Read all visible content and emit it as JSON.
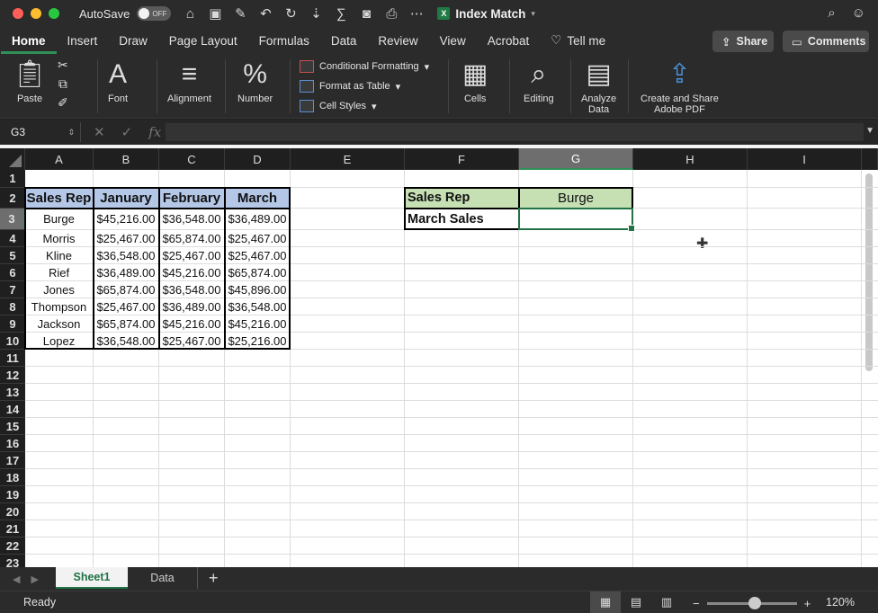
{
  "titlebar": {
    "autosave_label": "AutoSave",
    "autosave_state": "OFF",
    "doc_title": "Index Match",
    "doc_badge": "X"
  },
  "tabs": [
    "Home",
    "Insert",
    "Draw",
    "Page Layout",
    "Formulas",
    "Data",
    "Review",
    "View",
    "Acrobat"
  ],
  "tellme": "Tell me",
  "share": "Share",
  "comments": "Comments",
  "ribbon": {
    "paste": "Paste",
    "font": "Font",
    "alignment": "Alignment",
    "number": "Number",
    "conditional_formatting": "Conditional Formatting",
    "format_as_table": "Format as Table",
    "cell_styles": "Cell Styles",
    "cells": "Cells",
    "editing": "Editing",
    "analyze_data_1": "Analyze",
    "analyze_data_2": "Data",
    "create_share_1": "Create and Share",
    "create_share_2": "Adobe PDF"
  },
  "formula_bar": {
    "name_box": "G3",
    "fx": "fx",
    "value": ""
  },
  "grid": {
    "columns": [
      "A",
      "B",
      "C",
      "D",
      "E",
      "F",
      "G",
      "H",
      "I"
    ],
    "rows": [
      "1",
      "2",
      "3",
      "4",
      "5",
      "6",
      "7",
      "8",
      "9",
      "10",
      "11",
      "12",
      "13",
      "14",
      "15",
      "16",
      "17",
      "18",
      "19",
      "20",
      "21",
      "22",
      "23"
    ],
    "selected_column": "G",
    "selected_row": "3",
    "table_headers": [
      "Sales Rep",
      "January",
      "February",
      "March"
    ],
    "table_rows": [
      [
        "Burge",
        "$45,216.00",
        "$36,548.00",
        "$36,489.00"
      ],
      [
        "Morris",
        "$25,467.00",
        "$65,874.00",
        "$25,467.00"
      ],
      [
        "Kline",
        "$36,548.00",
        "$25,467.00",
        "$25,467.00"
      ],
      [
        "Rief",
        "$36,489.00",
        "$45,216.00",
        "$65,874.00"
      ],
      [
        "Jones",
        "$65,874.00",
        "$36,548.00",
        "$45,896.00"
      ],
      [
        "Thompson",
        "$25,467.00",
        "$36,489.00",
        "$36,548.00"
      ],
      [
        "Jackson",
        "$65,874.00",
        "$45,216.00",
        "$45,216.00"
      ],
      [
        "Lopez",
        "$36,548.00",
        "$25,467.00",
        "$25,216.00"
      ]
    ],
    "lookup": {
      "label1": "Sales Rep",
      "value1": "Burge",
      "label2": "March Sales",
      "value2": ""
    }
  },
  "sheets": [
    "Sheet1",
    "Data"
  ],
  "add_sheet": "+",
  "status": "Ready",
  "zoom": "120%",
  "colors": {
    "accent": "#217346",
    "header_fill": "#b4c7e7",
    "lookup_fill": "#c6e0b4"
  }
}
